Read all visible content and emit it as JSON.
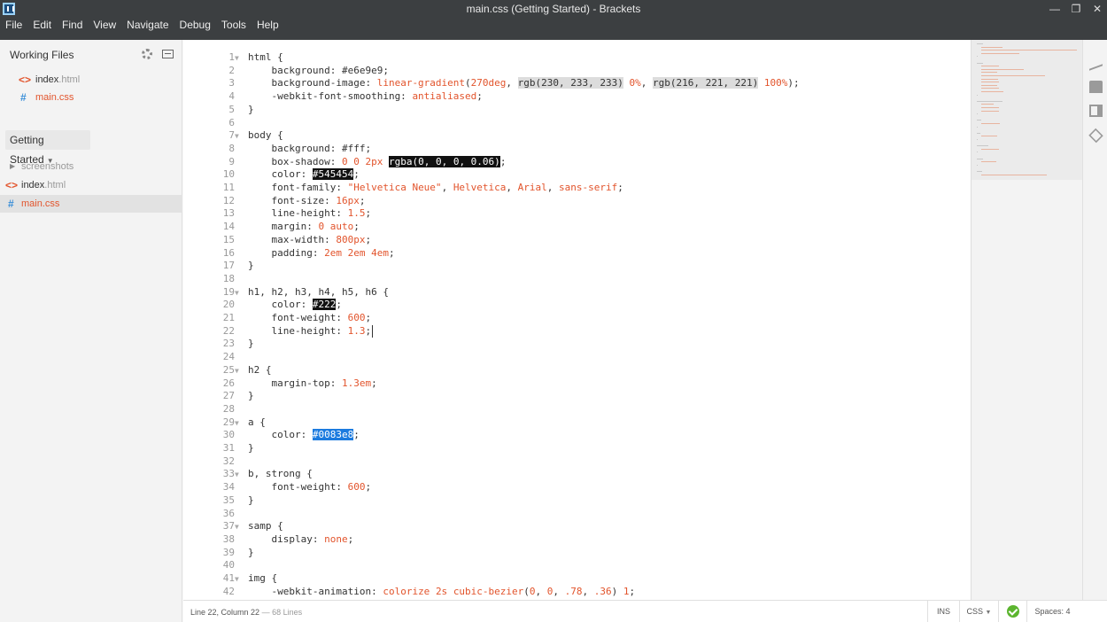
{
  "window": {
    "title": "main.css (Getting Started) - Brackets",
    "minimize": "—",
    "restore": "❐",
    "close": "✕"
  },
  "menu": [
    "File",
    "Edit",
    "Find",
    "View",
    "Navigate",
    "Debug",
    "Tools",
    "Help"
  ],
  "sidebar": {
    "working_files_header": "Working Files",
    "working_files": [
      {
        "base": "index",
        "ext": ".html",
        "type": "html"
      },
      {
        "base": "main.css",
        "ext": "",
        "type": "css"
      }
    ],
    "project_name": "Getting Started",
    "project_tree": [
      {
        "name": "screenshots",
        "type": "folder"
      },
      {
        "base": "index",
        "ext": ".html",
        "type": "html"
      },
      {
        "base": "main.css",
        "ext": "",
        "type": "css",
        "selected": true
      }
    ]
  },
  "editor": {
    "lines": [
      "html {",
      "    background: #e6e9e9;",
      "    background-image: linear-gradient(270deg, rgb(230, 233, 233) 0%, rgb(216, 221, 221) 100%);",
      "    -webkit-font-smoothing: antialiased;",
      "}",
      "",
      "body {",
      "    background: #fff;",
      "    box-shadow: 0 0 2px rgba(0, 0, 0, 0.06);",
      "    color: #545454;",
      "    font-family: \"Helvetica Neue\", Helvetica, Arial, sans-serif;",
      "    font-size: 16px;",
      "    line-height: 1.5;",
      "    margin: 0 auto;",
      "    max-width: 800px;",
      "    padding: 2em 2em 4em;",
      "}",
      "",
      "h1, h2, h3, h4, h5, h6 {",
      "    color: #222;",
      "    font-weight: 600;",
      "    line-height: 1.3;",
      "}",
      "",
      "h2 {",
      "    margin-top: 1.3em;",
      "}",
      "",
      "a {",
      "    color: #0083e8;",
      "}",
      "",
      "b, strong {",
      "    font-weight: 600;",
      "}",
      "",
      "samp {",
      "    display: none;",
      "}",
      "",
      "img {",
      "    -webkit-animation: colorize 2s cubic-bezier(0, 0, .78, .36) 1;"
    ],
    "fold_lines": [
      1,
      7,
      19,
      25,
      29,
      33,
      37,
      41
    ]
  },
  "status": {
    "cursor": "Line 22, Column 22",
    "line_count": "— 68 Lines",
    "mode": "INS",
    "language": "CSS",
    "spaces": "Spaces: 4"
  },
  "colors": {
    "titlebar": "#3c3f41",
    "accent": "#e2542c",
    "css_icon": "#3b8fd8",
    "ok": "#5cb52f"
  }
}
